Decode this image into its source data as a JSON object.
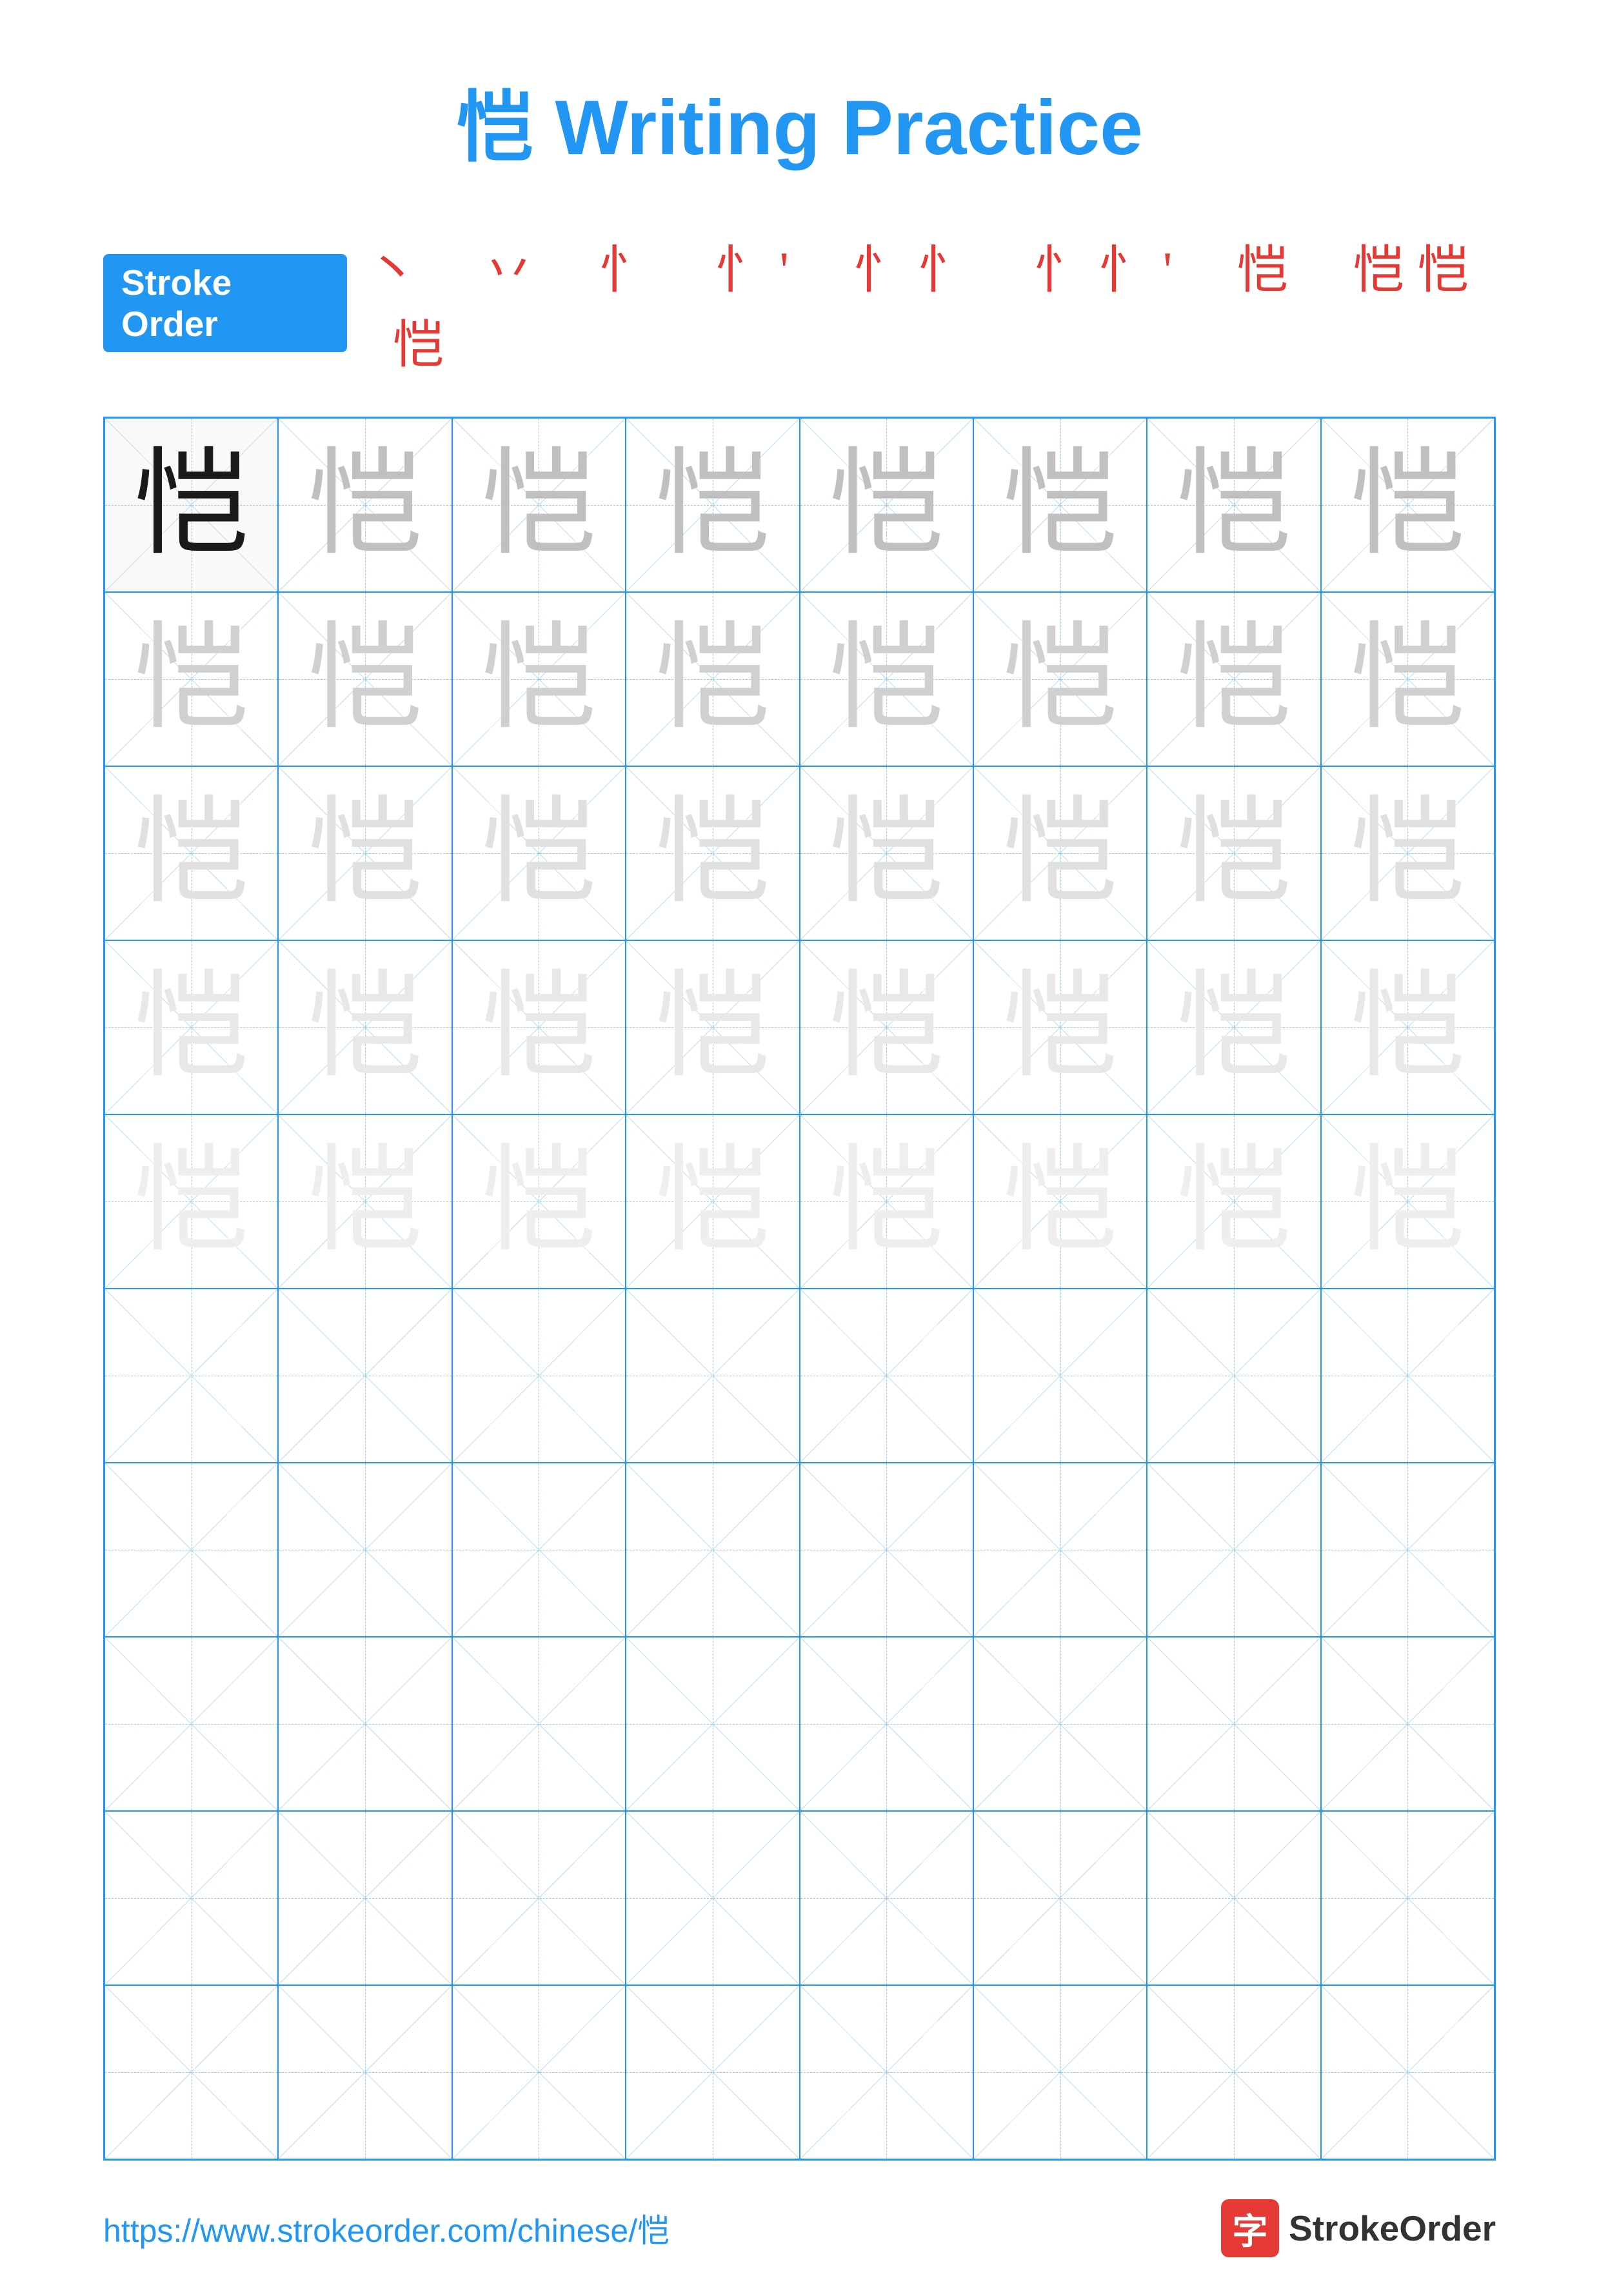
{
  "page": {
    "title_char": "恺",
    "title_text": " Writing Practice",
    "stroke_order_label": "Stroke Order",
    "stroke_order_chars": "丶 丷 忄 忄' 忄忄 忄忄' 恺 恺恺 恺",
    "practice_char": "恺",
    "footer_url": "https://www.strokeorder.com/chinese/恺",
    "footer_logo_char": "字",
    "footer_logo_name": "StrokeOrder"
  }
}
